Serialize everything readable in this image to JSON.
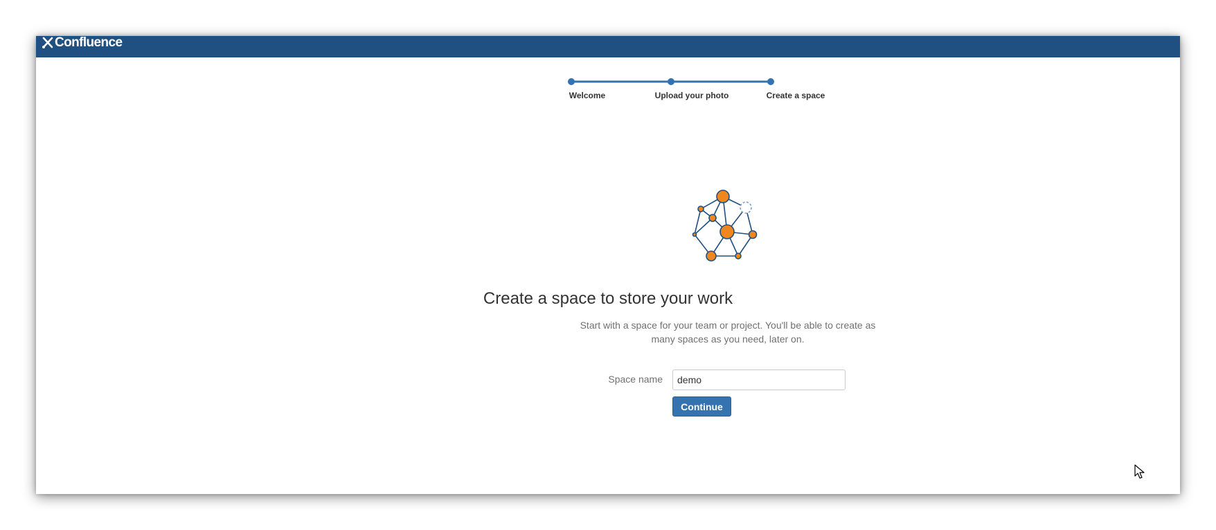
{
  "app": {
    "name": "Confluence",
    "brand_color": "#205081",
    "logo_icon": "confluence-logo-icon"
  },
  "onboarding": {
    "steps": [
      {
        "label": "Welcome",
        "state": "complete"
      },
      {
        "label": "Upload your photo",
        "state": "complete"
      },
      {
        "label": "Create a space",
        "state": "current"
      }
    ],
    "progress_color": "#3572b0"
  },
  "illustration": {
    "icon": "space-network-icon",
    "node_color": "#f0861e",
    "line_color": "#205081"
  },
  "main": {
    "headline": "Create a space to store your work",
    "description": "Start with a space for your team or project. You'll be able to create as many spaces as you need, later on."
  },
  "form": {
    "space_name_label": "Space name",
    "space_name_value": "demo",
    "continue_label": "Continue",
    "button_color": "#3572b0"
  }
}
